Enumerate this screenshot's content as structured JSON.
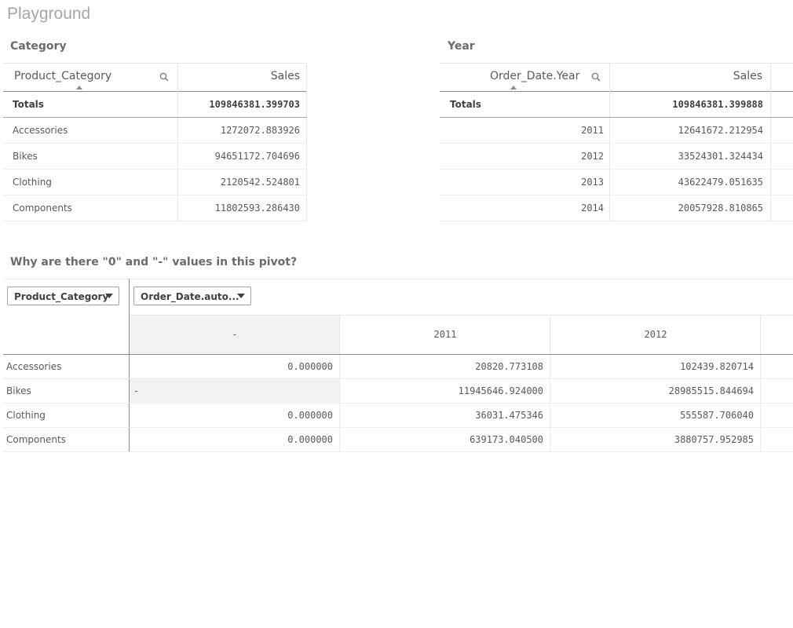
{
  "sheet": {
    "title": "Playground"
  },
  "category_table": {
    "title": "Category",
    "dimension_header": "Product_Category",
    "measure_header": "Sales",
    "totals_label": "Totals",
    "totals_value": "109846381.399703",
    "rows": [
      {
        "label": "Accessories",
        "value": "1272072.883926"
      },
      {
        "label": "Bikes",
        "value": "94651172.704696"
      },
      {
        "label": "Clothing",
        "value": "2120542.524801"
      },
      {
        "label": "Components",
        "value": "11802593.286430"
      }
    ]
  },
  "year_table": {
    "title": "Year",
    "dimension_header": "Order_Date.Year",
    "measure_header": "Sales",
    "totals_label": "Totals",
    "totals_value": "109846381.399888",
    "rows": [
      {
        "label": "2011",
        "value": "12641672.212954"
      },
      {
        "label": "2012",
        "value": "33524301.324434"
      },
      {
        "label": "2013",
        "value": "43622479.051635"
      },
      {
        "label": "2014",
        "value": "20057928.810865"
      }
    ]
  },
  "pivot": {
    "title": "Why are there \"0\" and \"-\" values in this pivot?",
    "row_dimension": "Product_Category",
    "column_dimension": "Order_Date.auto...",
    "columns": [
      "-",
      "2011",
      "2012"
    ],
    "rows": [
      {
        "label": "Accessories",
        "values": [
          "0.000000",
          "20820.773108",
          "102439.820714"
        ]
      },
      {
        "label": "Bikes",
        "values": [
          "-",
          "11945646.924000",
          "28985515.844694"
        ]
      },
      {
        "label": "Clothing",
        "values": [
          "0.000000",
          "36031.475346",
          "555587.706040"
        ]
      },
      {
        "label": "Components",
        "values": [
          "0.000000",
          "639173.040500",
          "3880757.952985"
        ]
      }
    ]
  }
}
